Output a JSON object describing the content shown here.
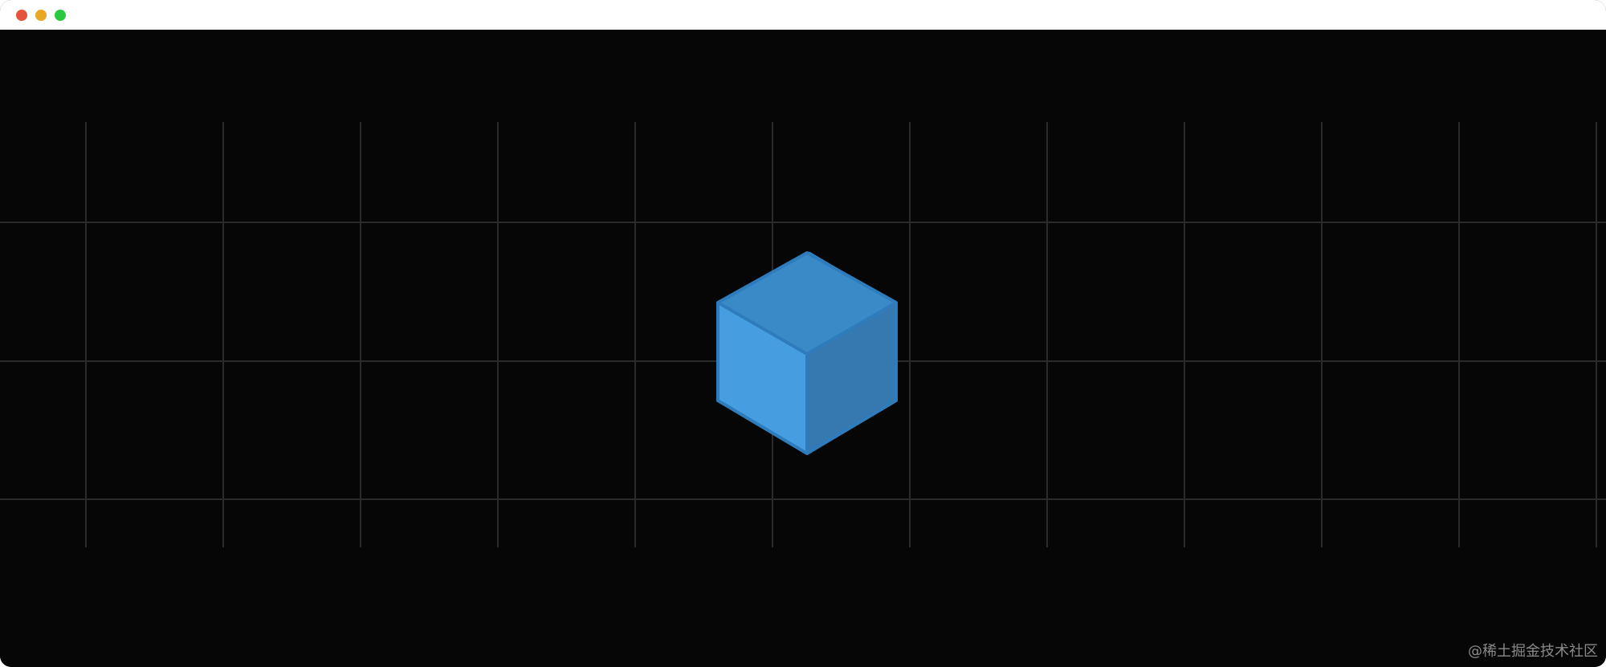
{
  "window": {
    "controls": {
      "close_color": "#e5533d",
      "minimize_color": "#e9a823",
      "maximize_color": "#2ac840"
    }
  },
  "canvas": {
    "background": "#060606",
    "grid_color": "#2a2a2a",
    "cube": {
      "icon": "cube-icon",
      "top_color": "#3a8ac7",
      "left_color": "#469ee0",
      "right_color": "#3579b0",
      "edge_color": "#2f7cbd"
    }
  },
  "watermark": {
    "text": "@稀土掘金技术社区"
  }
}
